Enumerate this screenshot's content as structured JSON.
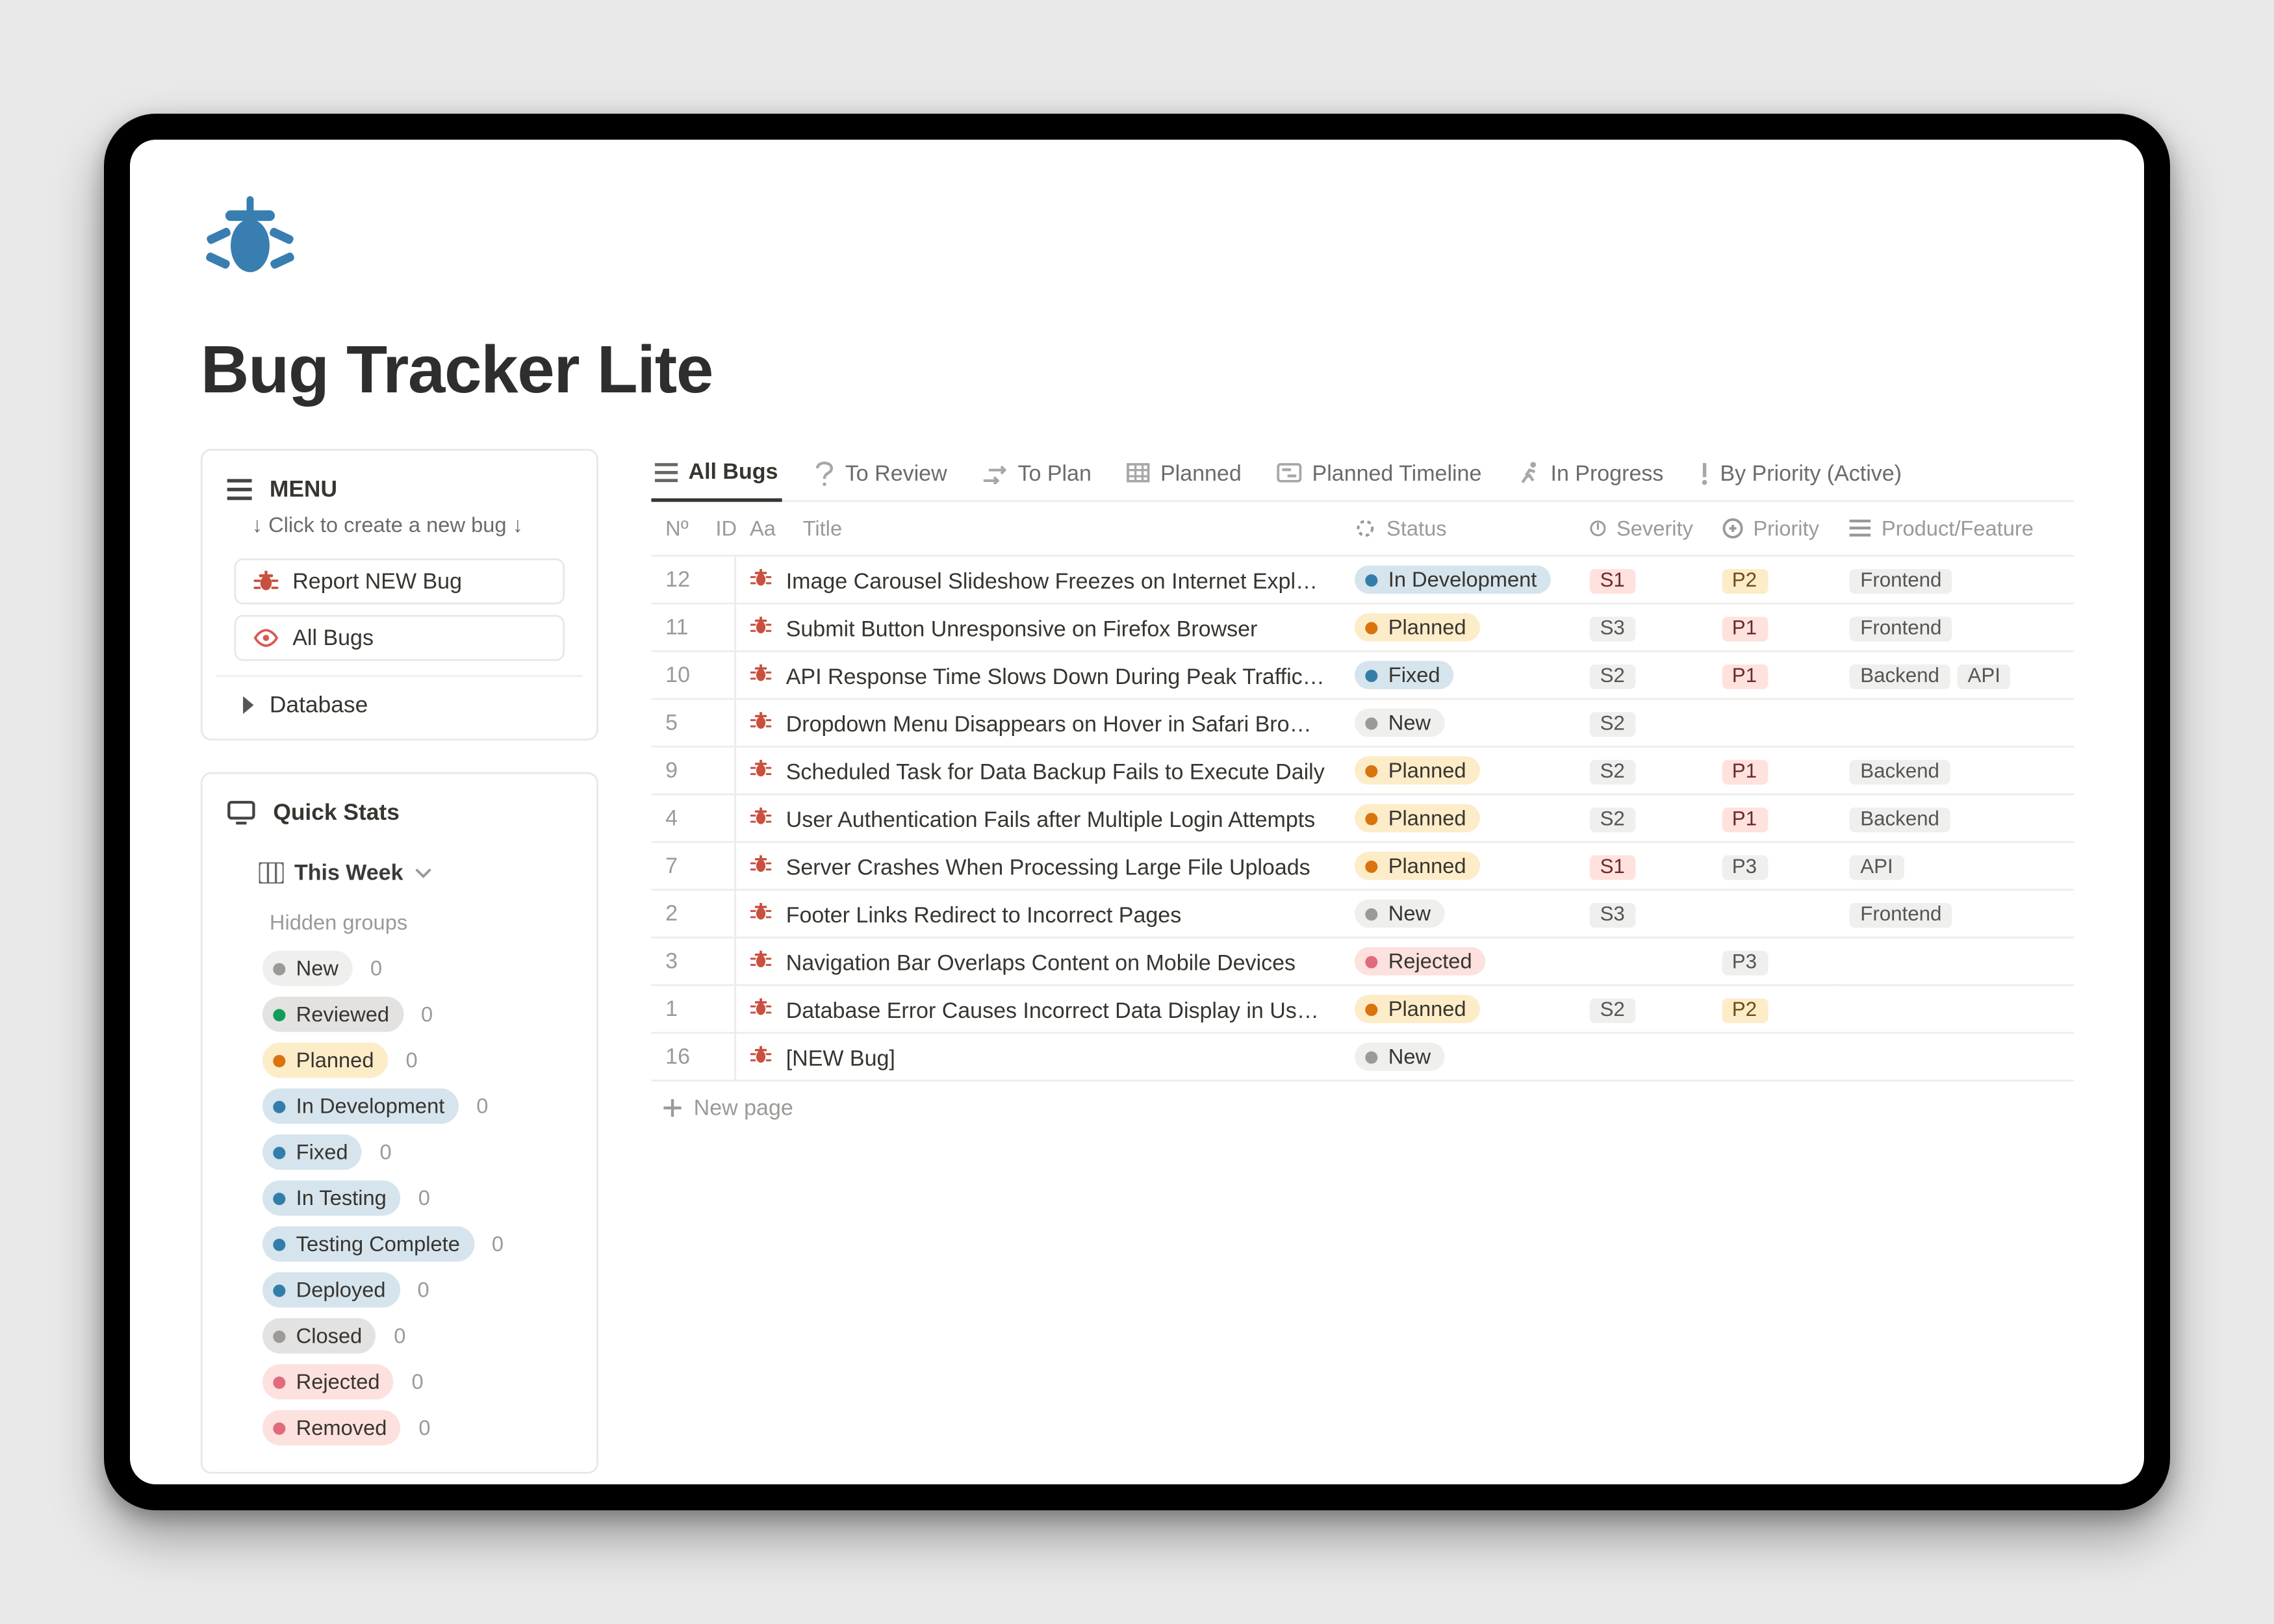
{
  "page": {
    "title": "Bug Tracker Lite"
  },
  "sidebar": {
    "menu_label": "MENU",
    "hint": "↓ Click to create a new bug ↓",
    "report_btn": "Report NEW Bug",
    "allbugs_btn": "All Bugs",
    "database_label": "Database"
  },
  "quickstats": {
    "heading": "Quick Stats",
    "week_label": "This Week",
    "hidden_label": "Hidden groups",
    "groups": [
      {
        "label": "New",
        "count": "0",
        "pill": "p-gray",
        "dot": "d-gray"
      },
      {
        "label": "Reviewed",
        "count": "0",
        "pill": "p-grayd",
        "dot": "d-green"
      },
      {
        "label": "Planned",
        "count": "0",
        "pill": "p-yellow",
        "dot": "d-orange"
      },
      {
        "label": "In Development",
        "count": "0",
        "pill": "p-blue",
        "dot": "d-blue"
      },
      {
        "label": "Fixed",
        "count": "0",
        "pill": "p-blue",
        "dot": "d-blue"
      },
      {
        "label": "In Testing",
        "count": "0",
        "pill": "p-blue",
        "dot": "d-blue"
      },
      {
        "label": "Testing Complete",
        "count": "0",
        "pill": "p-blue",
        "dot": "d-blue"
      },
      {
        "label": "Deployed",
        "count": "0",
        "pill": "p-blue",
        "dot": "d-blue"
      },
      {
        "label": "Closed",
        "count": "0",
        "pill": "p-grayd",
        "dot": "d-gray"
      },
      {
        "label": "Rejected",
        "count": "0",
        "pill": "p-pink",
        "dot": "d-pink"
      },
      {
        "label": "Removed",
        "count": "0",
        "pill": "p-pink",
        "dot": "d-pink"
      }
    ]
  },
  "tabs": [
    {
      "label": "All Bugs",
      "icon": "list"
    },
    {
      "label": "To Review",
      "icon": "question"
    },
    {
      "label": "To Plan",
      "icon": "plan"
    },
    {
      "label": "Planned",
      "icon": "table"
    },
    {
      "label": "Planned Timeline",
      "icon": "timeline"
    },
    {
      "label": "In Progress",
      "icon": "runner"
    },
    {
      "label": "By Priority (Active)",
      "icon": "exclaim"
    }
  ],
  "table": {
    "headers": {
      "id": "ID",
      "title": "Title",
      "status": "Status",
      "severity": "Severity",
      "priority": "Priority",
      "product": "Product/Feature"
    },
    "labels": {
      "id_prefix": "Nº",
      "title_prefix": "Aa"
    },
    "new_page": "New page",
    "rows": [
      {
        "id": "12",
        "title": "Image Carousel Slideshow Freezes on Internet Explorer",
        "status": {
          "label": "In Development",
          "pill": "p-blue",
          "dot": "d-blue"
        },
        "severity": {
          "label": "S1",
          "cls": "sev-red"
        },
        "priority": {
          "label": "P2",
          "cls": "pri-yel"
        },
        "tags": [
          "Frontend"
        ]
      },
      {
        "id": "11",
        "title": "Submit Button Unresponsive on Firefox Browser",
        "status": {
          "label": "Planned",
          "pill": "p-yellow",
          "dot": "d-orange"
        },
        "severity": {
          "label": "S3",
          "cls": "sev-gray"
        },
        "priority": {
          "label": "P1",
          "cls": "pri-red"
        },
        "tags": [
          "Frontend"
        ]
      },
      {
        "id": "10",
        "title": "API Response Time Slows Down During Peak Traffic Hours",
        "status": {
          "label": "Fixed",
          "pill": "p-blue",
          "dot": "d-blue"
        },
        "severity": {
          "label": "S2",
          "cls": "sev-gray"
        },
        "priority": {
          "label": "P1",
          "cls": "pri-red"
        },
        "tags": [
          "Backend",
          "API"
        ]
      },
      {
        "id": "5",
        "title": "Dropdown Menu Disappears on Hover in Safari Browser",
        "status": {
          "label": "New",
          "pill": "p-gray",
          "dot": "d-gray"
        },
        "severity": {
          "label": "S2",
          "cls": "sev-gray"
        },
        "priority": null,
        "tags": []
      },
      {
        "id": "9",
        "title": "Scheduled Task for Data Backup Fails to Execute Daily",
        "status": {
          "label": "Planned",
          "pill": "p-yellow",
          "dot": "d-orange"
        },
        "severity": {
          "label": "S2",
          "cls": "sev-gray"
        },
        "priority": {
          "label": "P1",
          "cls": "pri-red"
        },
        "tags": [
          "Backend"
        ]
      },
      {
        "id": "4",
        "title": "User Authentication Fails after Multiple Login Attempts",
        "status": {
          "label": "Planned",
          "pill": "p-yellow",
          "dot": "d-orange"
        },
        "severity": {
          "label": "S2",
          "cls": "sev-gray"
        },
        "priority": {
          "label": "P1",
          "cls": "pri-red"
        },
        "tags": [
          "Backend"
        ]
      },
      {
        "id": "7",
        "title": "Server Crashes When Processing Large File Uploads",
        "status": {
          "label": "Planned",
          "pill": "p-yellow",
          "dot": "d-orange"
        },
        "severity": {
          "label": "S1",
          "cls": "sev-red"
        },
        "priority": {
          "label": "P3",
          "cls": "pri-gray"
        },
        "tags": [
          "API"
        ]
      },
      {
        "id": "2",
        "title": "Footer Links Redirect to Incorrect Pages",
        "status": {
          "label": "New",
          "pill": "p-gray",
          "dot": "d-gray"
        },
        "severity": {
          "label": "S3",
          "cls": "sev-gray"
        },
        "priority": null,
        "tags": [
          "Frontend"
        ]
      },
      {
        "id": "3",
        "title": "Navigation Bar Overlaps Content on Mobile Devices",
        "status": {
          "label": "Rejected",
          "pill": "p-pink",
          "dot": "d-pink"
        },
        "severity": null,
        "priority": {
          "label": "P3",
          "cls": "pri-gray"
        },
        "tags": []
      },
      {
        "id": "1",
        "title": "Database Error Causes Incorrect Data Display in User Profiles",
        "status": {
          "label": "Planned",
          "pill": "p-yellow",
          "dot": "d-orange"
        },
        "severity": {
          "label": "S2",
          "cls": "sev-gray"
        },
        "priority": {
          "label": "P2",
          "cls": "pri-yel"
        },
        "tags": []
      },
      {
        "id": "16",
        "title": "[NEW Bug]",
        "status": {
          "label": "New",
          "pill": "p-gray",
          "dot": "d-gray"
        },
        "severity": null,
        "priority": null,
        "tags": []
      }
    ]
  }
}
